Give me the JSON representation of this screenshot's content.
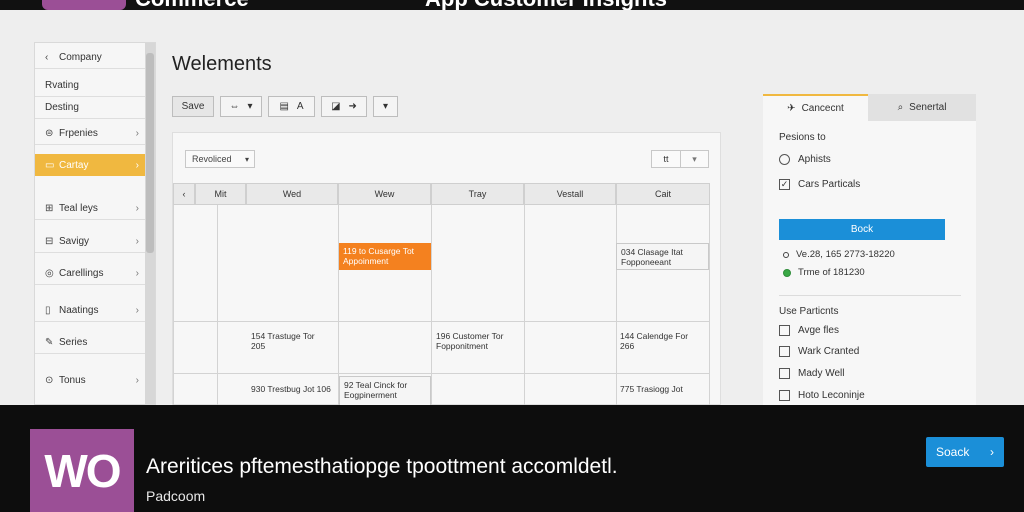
{
  "top_strip": {
    "brand": "Commerce",
    "headline_fragment": "App Customer Insights"
  },
  "sidebar": {
    "items": [
      {
        "icon": "back-arrow-icon",
        "glyph": "‹",
        "label": "Company",
        "chevron": false
      },
      {
        "icon": "",
        "glyph": "",
        "label": "Rvating",
        "chevron": false
      },
      {
        "icon": "",
        "glyph": "",
        "label": "Desting",
        "chevron": false
      },
      {
        "icon": "dollar-icon",
        "glyph": "⊜",
        "label": "Frpenies",
        "chevron": true
      },
      {
        "icon": "calendar-icon",
        "glyph": "▭",
        "label": "Cartay",
        "chevron": true
      },
      {
        "icon": "tools-icon",
        "glyph": "⊞",
        "label": "Teal leys",
        "chevron": true
      },
      {
        "icon": "savings-icon",
        "glyph": "⊟",
        "label": "Savigy",
        "chevron": true
      },
      {
        "icon": "calls-icon",
        "glyph": "◎",
        "label": "Carellings",
        "chevron": true
      },
      {
        "icon": "notes-icon",
        "glyph": "▯",
        "label": "Naatings",
        "chevron": true
      },
      {
        "icon": "pencil-icon",
        "glyph": "✎",
        "label": "Series",
        "chevron": false
      },
      {
        "icon": "clock-icon",
        "glyph": "⊙",
        "label": "Tonus",
        "chevron": true
      }
    ]
  },
  "main": {
    "title": "Welements",
    "toolbar": {
      "save_label": "Save",
      "link_glyph": "⇔",
      "format_glyph": "▤",
      "text_glyph": "A",
      "align_glyph": "◪",
      "arrow_glyph": "➜",
      "dropdown_glyph": "▾"
    },
    "filter_value": "Revoliced",
    "filter_right_value": "tt",
    "calendar": {
      "nav_glyph": "‹",
      "columns": [
        "Mit",
        "Wed",
        "Wew",
        "Tray",
        "Vestall",
        "Cait"
      ],
      "events": [
        {
          "text": "119 to Cusarge Tot Appoinment",
          "style": "orange"
        },
        {
          "text": "034 Clasage Itat Fopponeeant",
          "style": "boxed"
        },
        {
          "text": "154 Trastuge Tor 205",
          "style": "plain"
        },
        {
          "text": "196 Customer Tor Fopponitment",
          "style": "plain"
        },
        {
          "text": "144 Calendge For 266",
          "style": "plain"
        },
        {
          "text": "930 Trestbug Jot 106",
          "style": "plain"
        },
        {
          "text": "92 Teal Cinck for Eogpinerment",
          "style": "boxed"
        },
        {
          "text": "775 Trasiogg Jot",
          "style": "plain"
        }
      ]
    }
  },
  "right_panel": {
    "tab1_glyph": "✈",
    "tab1_label": "Cancecnt",
    "tab2_glyph": "⌕",
    "tab2_label": "Senertal",
    "section1_label": "Pesions to",
    "options": [
      {
        "type": "radio",
        "label": "Aphists",
        "checked": false
      },
      {
        "type": "checkbox",
        "label": "Cars Particals",
        "checked": true
      }
    ],
    "book_label": "Bock",
    "info_lines": [
      "Ve.28, 165 2773-18220",
      "Trme of 181230"
    ],
    "section2_label": "Use Particnts",
    "checklist": [
      "Avge fles",
      "Wark Cranted",
      "Mady Well",
      "Hoto Leconinje"
    ]
  },
  "banner": {
    "logo_text": "WO",
    "headline": "Areritices pftemesthatiopge tpoottment accomldetl.",
    "subhead": "Padcoom",
    "cta_label": "Soack",
    "cta_glyph": "›"
  },
  "colors": {
    "accent_orange": "#f4811f",
    "sidebar_active": "#f0b840",
    "primary_blue": "#1b8fd8",
    "woo_purple": "#9b4f96",
    "status_green": "#39a845"
  }
}
